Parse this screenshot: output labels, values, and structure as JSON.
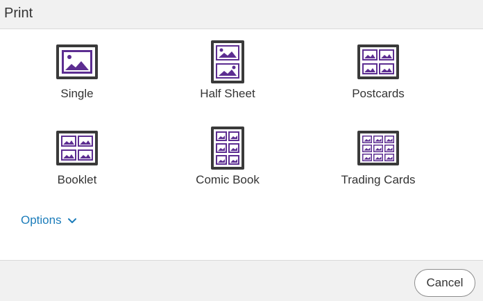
{
  "header": {
    "title": "Print"
  },
  "layouts": [
    {
      "label": "Single",
      "icon": "single-print-icon"
    },
    {
      "label": "Half Sheet",
      "icon": "half-sheet-print-icon"
    },
    {
      "label": "Postcards",
      "icon": "postcards-print-icon"
    },
    {
      "label": "Booklet",
      "icon": "booklet-print-icon"
    },
    {
      "label": "Comic Book",
      "icon": "comic-book-print-icon"
    },
    {
      "label": "Trading Cards",
      "icon": "trading-cards-print-icon"
    }
  ],
  "options": {
    "label": "Options",
    "icon": "chevron-down-icon"
  },
  "footer": {
    "cancel_label": "Cancel"
  },
  "colors": {
    "icon_frame": "#3a3a3a",
    "icon_accent": "#5c2d91",
    "link": "#1b7cba",
    "panel_bg": "#f1f1f1"
  }
}
